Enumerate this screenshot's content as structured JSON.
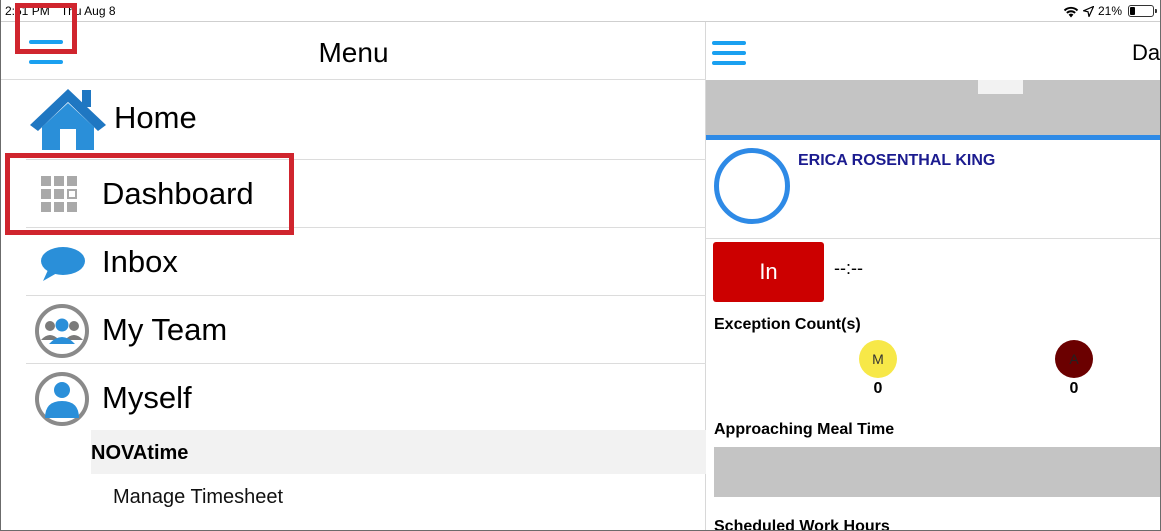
{
  "status_bar": {
    "time": "2:51 PM",
    "date": "Thu Aug 8",
    "battery_text": "21%",
    "battery_level": 0.21,
    "icons": [
      "wifi-icon",
      "location-arrow-icon",
      "battery-icon"
    ]
  },
  "menu": {
    "title": "Menu",
    "items": [
      {
        "label": "Home",
        "icon": "home-icon"
      },
      {
        "label": "Dashboard",
        "icon": "grid-icon"
      },
      {
        "label": "Inbox",
        "icon": "chat-bubble-icon"
      },
      {
        "label": "My Team",
        "icon": "team-icon"
      },
      {
        "label": "Myself",
        "icon": "person-icon"
      }
    ],
    "section": {
      "title": "NOVAtime",
      "items": [
        {
          "label": "Manage Timesheet"
        }
      ]
    }
  },
  "dashboard": {
    "title": "Da",
    "employee_name": "ERICA  ROSENTHAL KING",
    "punch_button": "In",
    "punch_time": "--:--",
    "exception_label": "Exception Count(s)",
    "exceptions": [
      {
        "badge": "M",
        "count": "0",
        "color": "#f7e848"
      },
      {
        "badge": "A",
        "count": "0",
        "color": "#6b0000"
      }
    ],
    "meal_label": "Approaching Meal Time",
    "scheduled_label": "Scheduled Work Hours"
  },
  "colors": {
    "accent": "#1aa0f0",
    "highlight": "#d0252e",
    "punch_button": "#cc0000",
    "name_text": "#1b1b8f",
    "ring": "#2e8ae6"
  }
}
